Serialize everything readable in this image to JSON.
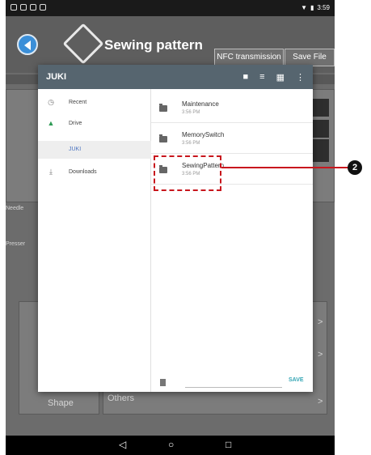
{
  "status_bar": {
    "time": "3:59"
  },
  "header": {
    "title": "Sewing pattern",
    "nfc_button": "NFC transmission",
    "save_file_button": "Save File"
  },
  "background": {
    "needle_label": "Needle",
    "presser_label": "Presser",
    "shape_label": "Shape",
    "others_label": "Others",
    "arrow": ">"
  },
  "dialog": {
    "title": "JUKI",
    "sidebar": [
      {
        "label": "Recent",
        "icon": "clock-icon"
      },
      {
        "label": "Drive",
        "icon": "drive-icon"
      },
      {
        "label": "JUKI",
        "icon": ""
      },
      {
        "label": "Downloads",
        "icon": "download-icon"
      }
    ],
    "files": [
      {
        "name": "Maintenance",
        "time": "3:56 PM"
      },
      {
        "name": "MemorySwitch",
        "time": "3:56 PM"
      },
      {
        "name": "SewingPattern",
        "time": "3:56 PM"
      }
    ],
    "save_button": "SAVE"
  },
  "callout": {
    "number": "2"
  },
  "nav": {
    "back": "◁",
    "home": "○",
    "recent": "□"
  }
}
